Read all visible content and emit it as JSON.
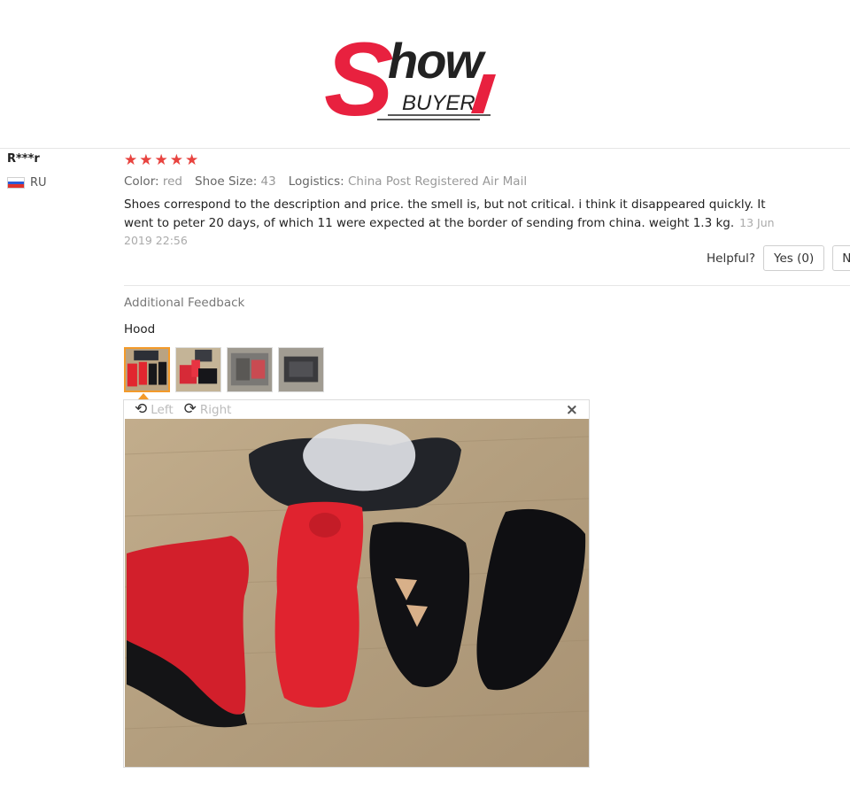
{
  "logo": {
    "word": "how",
    "initial": "S",
    "sub": "BUYER",
    "accent": "#e8213f"
  },
  "review": {
    "user": "R***r",
    "country": "RU",
    "rating": 5,
    "stars": [
      "★",
      "★",
      "★",
      "★",
      "★"
    ],
    "attributes": [
      {
        "label": "Color:",
        "value": "red"
      },
      {
        "label": "Shoe Size:",
        "value": "43"
      },
      {
        "label": "Logistics:",
        "value": "China Post Registered Air Mail"
      }
    ],
    "text": "Shoes correspond to the description and price. the smell is, but not critical. i think it disappeared quickly. It went to peter 20 days, of which 11 were expected at the border of sending from china. weight 1.3 kg.",
    "date": "13 Jun 2019 22:56",
    "helpful_label": "Helpful?",
    "yes_label": "Yes (0)",
    "no_label": "No"
  },
  "additional": {
    "title": "Additional Feedback",
    "text": "Hood",
    "thumbnail_count": 4,
    "active_thumbnail": 1
  },
  "viewer": {
    "rotate_left_label": "Left",
    "rotate_right_label": "Right",
    "rotate_left_icon": "rotate-left-icon",
    "rotate_right_icon": "rotate-right-icon",
    "close_icon": "close-icon",
    "close_glyph": "×",
    "left_glyph": "⟲",
    "right_glyph": "⟳"
  },
  "colors": {
    "star": "#e8433f",
    "thumb_active": "#f39a2a"
  }
}
